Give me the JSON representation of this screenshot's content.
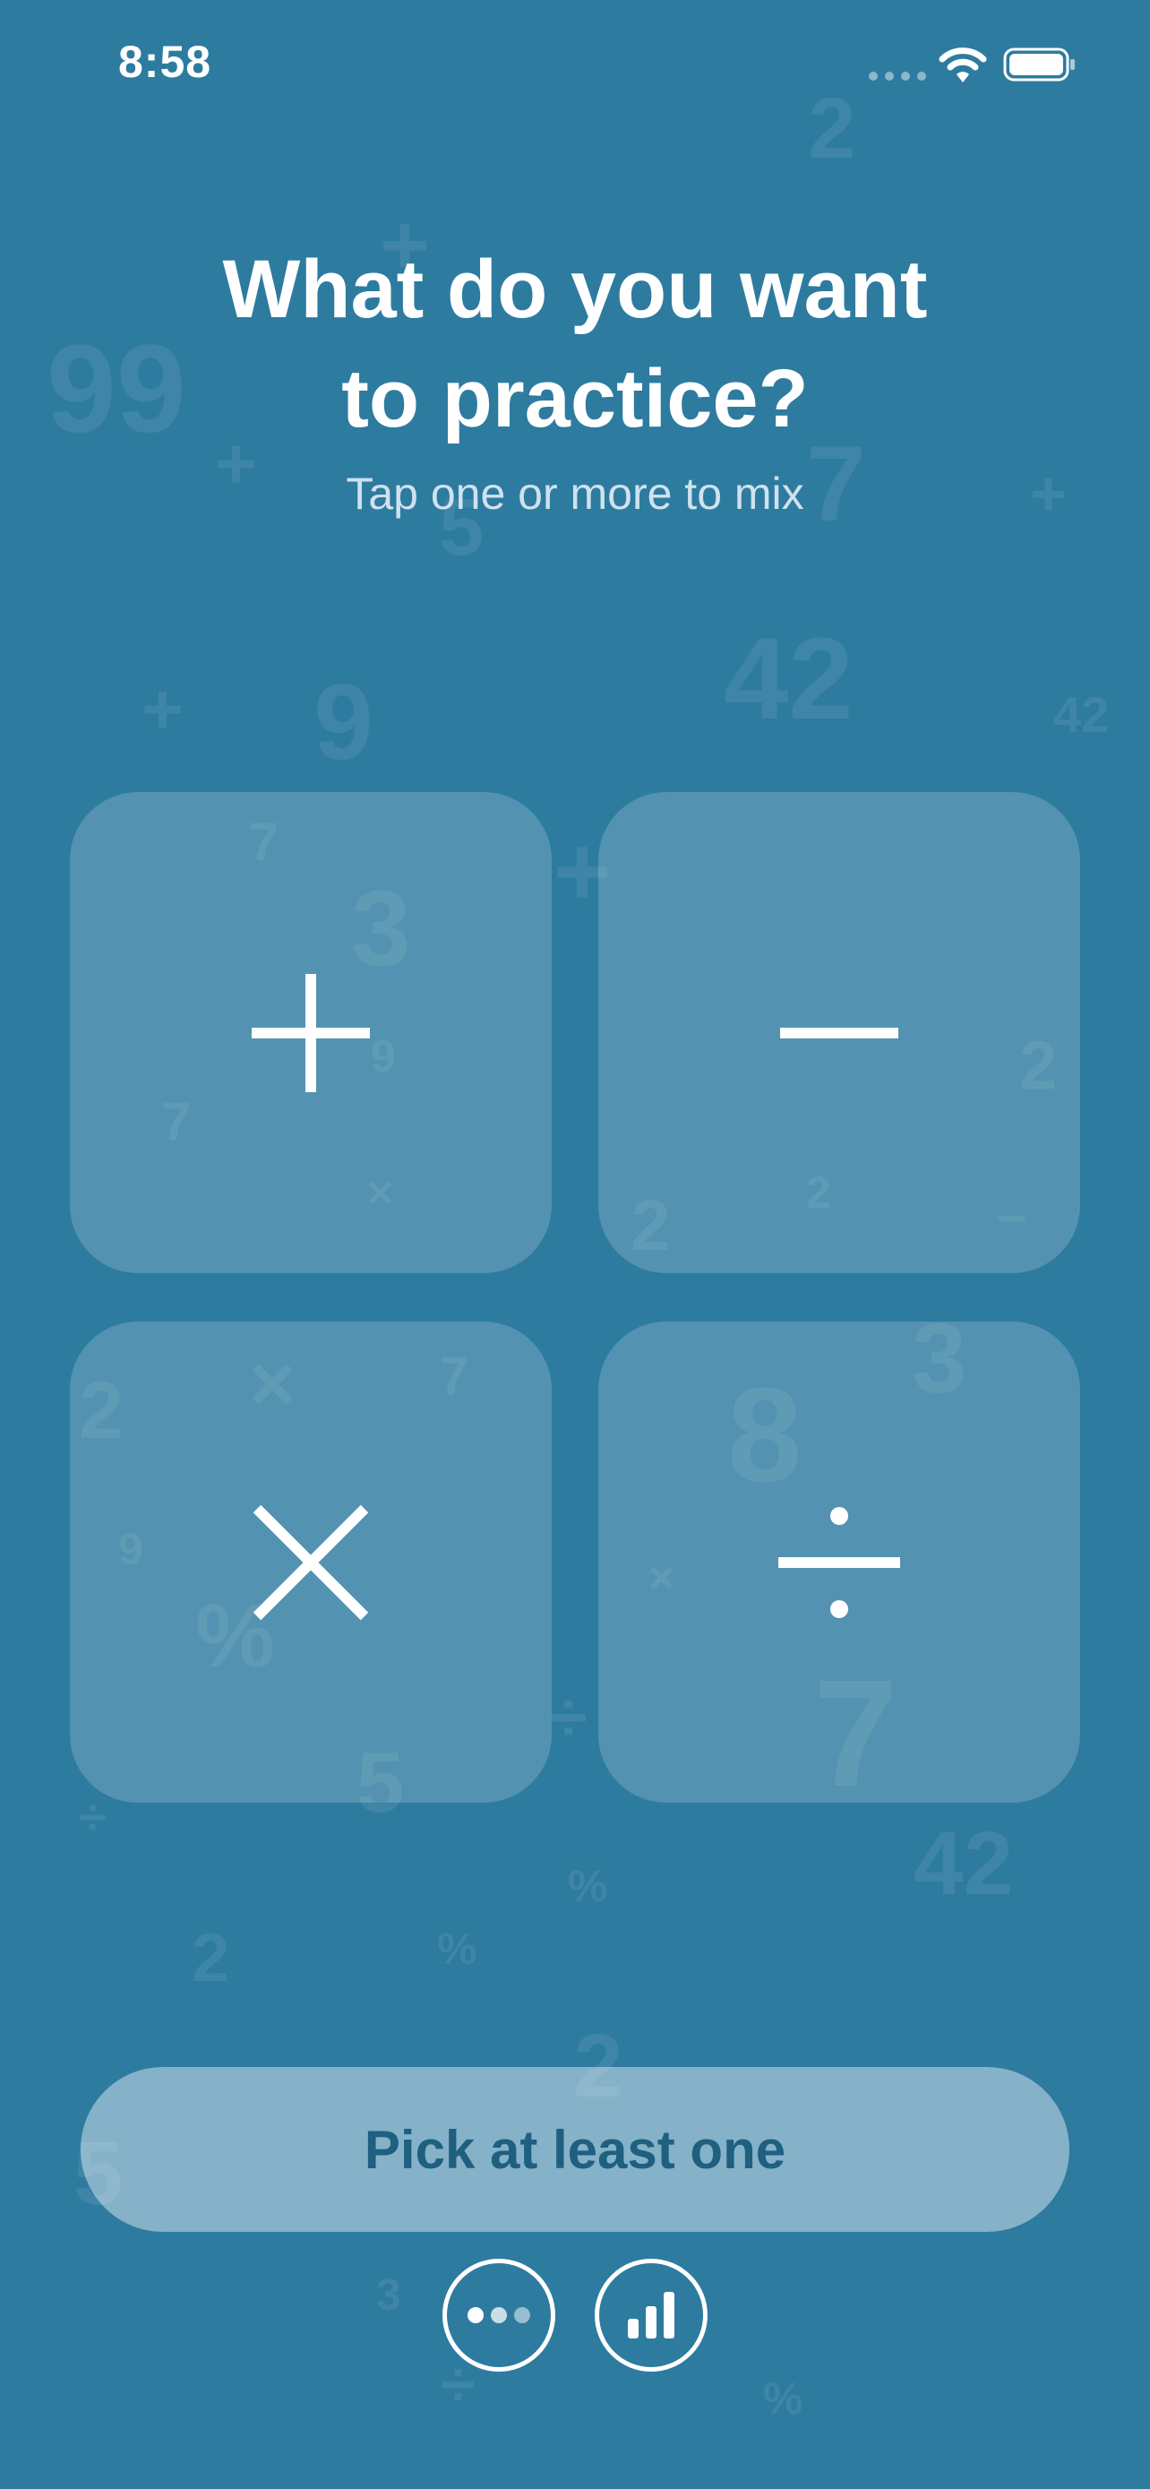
{
  "status_bar": {
    "time": "8:58"
  },
  "header": {
    "title": "What do you want\nto practice?",
    "subtitle": "Tap one or more to mix"
  },
  "operations": [
    {
      "name": "addition",
      "icon": "plus-icon"
    },
    {
      "name": "subtraction",
      "icon": "minus-icon"
    },
    {
      "name": "multiplication",
      "icon": "multiply-icon"
    },
    {
      "name": "division",
      "icon": "divide-icon"
    }
  ],
  "primary_button": {
    "label": "Pick at least one"
  },
  "footer": {
    "buttons": [
      {
        "icon": "more-icon"
      },
      {
        "icon": "stats-icon"
      }
    ]
  },
  "background_glyphs": [
    "2",
    "99",
    "+",
    "7",
    "3",
    "42",
    "9",
    "−",
    "×",
    "8",
    "5",
    "%",
    "÷"
  ],
  "colors": {
    "background": "#2e7ba0",
    "card": "rgba(255,255,255,0.18)",
    "button": "rgba(255,255,255,0.42)",
    "button_text": "#1f5f80",
    "foreground": "#ffffff"
  }
}
